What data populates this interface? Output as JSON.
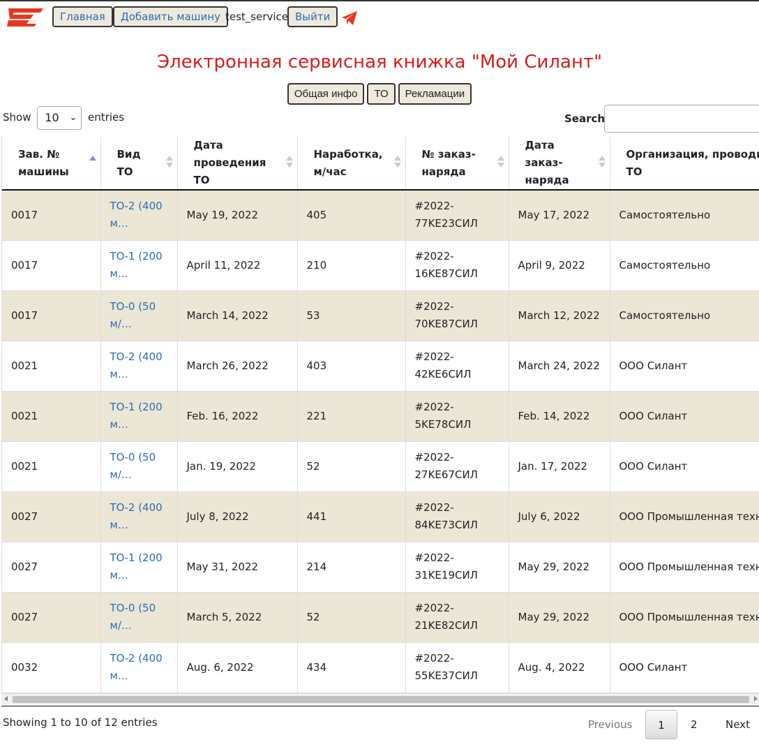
{
  "nav": {
    "home": "Главная",
    "add_car": "Добавить машину",
    "username": "test_service",
    "logout": "Выйти"
  },
  "brand_color": "#d41e1e",
  "title": "Электронная сервисная книжка \"Мой Силант\"",
  "tabs": [
    {
      "label": "Общая инфо"
    },
    {
      "label": "ТО"
    },
    {
      "label": "Рекламации"
    }
  ],
  "length": {
    "show": "Show",
    "value": "10",
    "entries": "entries"
  },
  "search": {
    "label": "Search:",
    "value": ""
  },
  "table": {
    "sort_column": "Зав. № машины",
    "headers": [
      "Зав. № машины",
      "Вид ТО",
      "Дата проведения ТО",
      "Наработка, м/час",
      "№ заказ-наряда",
      "Дата заказ-наряда",
      "Организация, проводившая ТО"
    ],
    "rows": [
      {
        "serial": "0017",
        "to_type": "ТО-2 (400 м…",
        "date": "May 19, 2022",
        "hours": "405",
        "order": "#2022-77KE23СИЛ",
        "order_date": "May 17, 2022",
        "org": "Самостоятельно"
      },
      {
        "serial": "0017",
        "to_type": "ТО-1 (200 м…",
        "date": "April 11, 2022",
        "hours": "210",
        "order": "#2022-16KE87СИЛ",
        "order_date": "April 9, 2022",
        "org": "Самостоятельно"
      },
      {
        "serial": "0017",
        "to_type": "ТО-0 (50 м/…",
        "date": "March 14, 2022",
        "hours": "53",
        "order": "#2022-70KE87СИЛ",
        "order_date": "March 12, 2022",
        "org": "Самостоятельно"
      },
      {
        "serial": "0021",
        "to_type": "ТО-2 (400 м…",
        "date": "March 26, 2022",
        "hours": "403",
        "order": "#2022-42KE6СИЛ",
        "order_date": "March 24, 2022",
        "org": "ООО Силант"
      },
      {
        "serial": "0021",
        "to_type": "ТО-1 (200 м…",
        "date": "Feb. 16, 2022",
        "hours": "221",
        "order": "#2022-5KE78СИЛ",
        "order_date": "Feb. 14, 2022",
        "org": "ООО Силант"
      },
      {
        "serial": "0021",
        "to_type": "ТО-0 (50 м/…",
        "date": "Jan. 19, 2022",
        "hours": "52",
        "order": "#2022-27KE67СИЛ",
        "order_date": "Jan. 17, 2022",
        "org": "ООО Силант"
      },
      {
        "serial": "0027",
        "to_type": "ТО-2 (400 м…",
        "date": "July 8, 2022",
        "hours": "441",
        "order": "#2022-84KE73СИЛ",
        "order_date": "July 6, 2022",
        "org": "ООО Промышленная техника"
      },
      {
        "serial": "0027",
        "to_type": "ТО-1 (200 м…",
        "date": "May 31, 2022",
        "hours": "214",
        "order": "#2022-31KE19СИЛ",
        "order_date": "May 29, 2022",
        "org": "ООО Промышленная техника"
      },
      {
        "serial": "0027",
        "to_type": "ТО-0 (50 м/…",
        "date": "March 5, 2022",
        "hours": "52",
        "order": "#2022-21KE82СИЛ",
        "order_date": "May 29, 2022",
        "org": "ООО Промышленная техника"
      },
      {
        "serial": "0032",
        "to_type": "ТО-2 (400 м…",
        "date": "Aug. 6, 2022",
        "hours": "434",
        "order": "#2022-55KE37СИЛ",
        "order_date": "Aug. 4, 2022",
        "org": "ООО Силант"
      }
    ]
  },
  "footer": {
    "info": "Showing 1 to 10 of 12 entries",
    "previous": "Previous",
    "pages": [
      "1",
      "2"
    ],
    "current_page": "1",
    "next": "Next"
  }
}
